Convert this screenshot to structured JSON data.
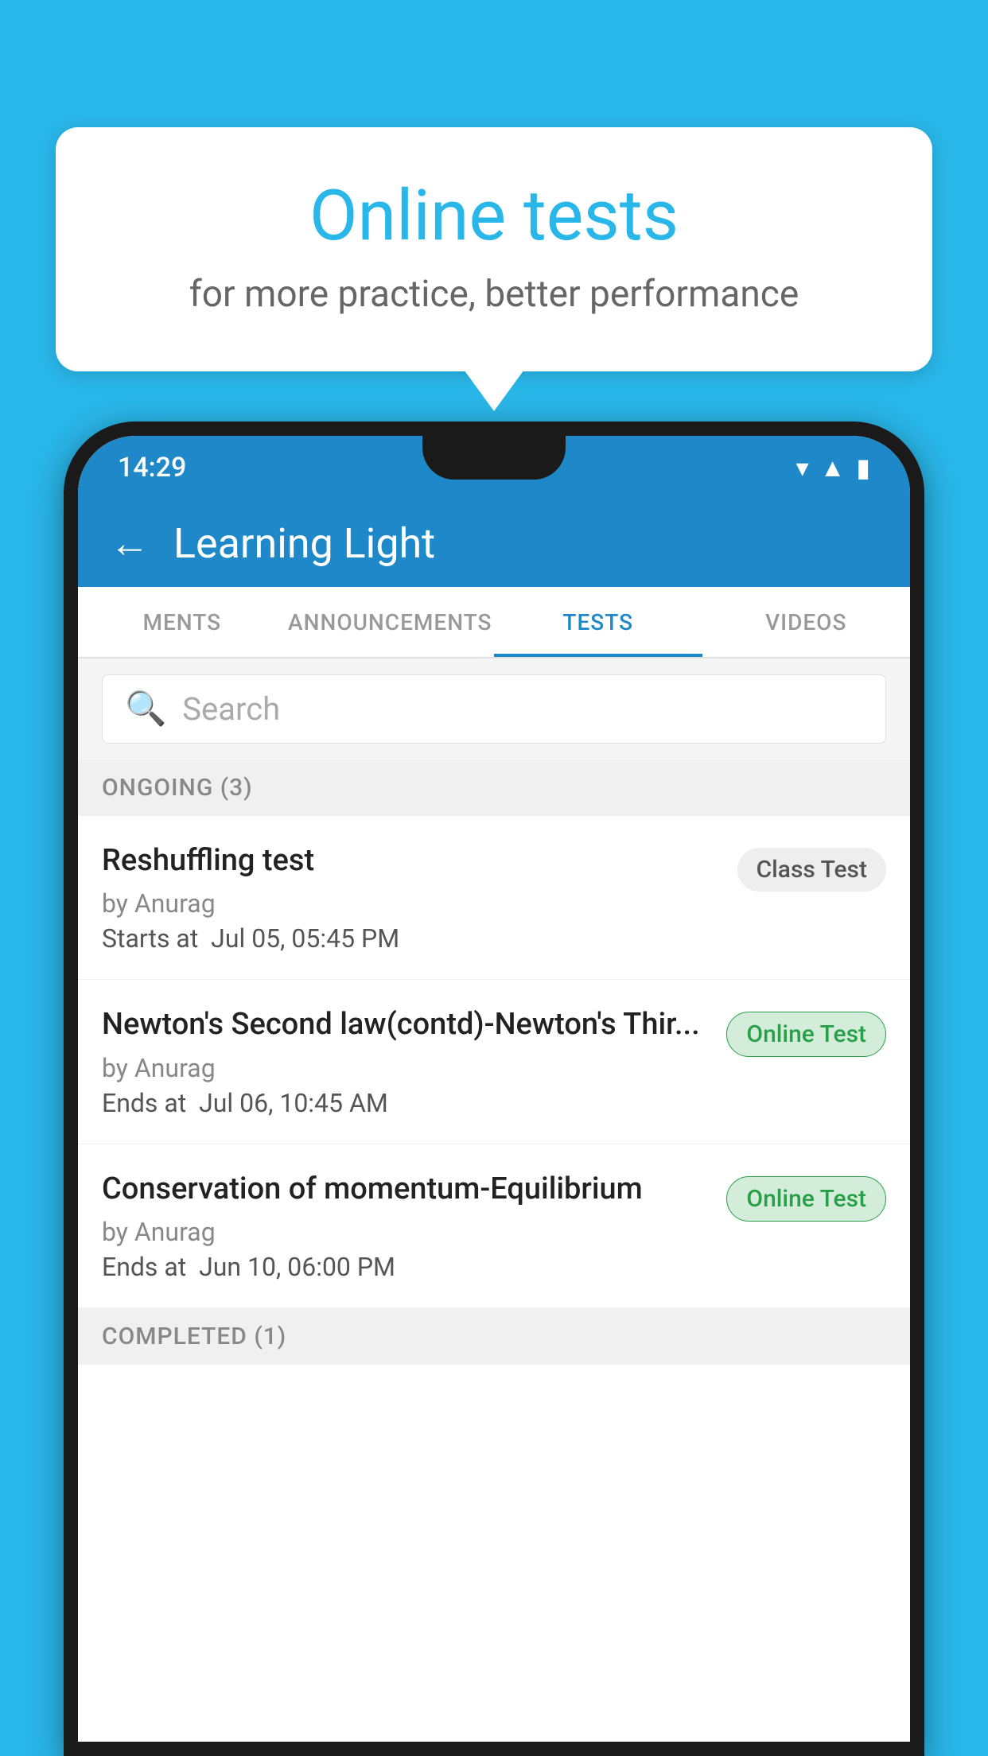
{
  "background": {
    "color": "#29b6e8"
  },
  "speech_bubble": {
    "title": "Online tests",
    "subtitle": "for more practice, better performance"
  },
  "phone": {
    "status_bar": {
      "time": "14:29",
      "icons": [
        "wifi",
        "signal",
        "battery"
      ]
    },
    "app_header": {
      "back_label": "←",
      "title": "Learning Light"
    },
    "tabs": [
      {
        "label": "MENTS",
        "active": false
      },
      {
        "label": "ANNOUNCEMENTS",
        "active": false
      },
      {
        "label": "TESTS",
        "active": true
      },
      {
        "label": "VIDEOS",
        "active": false
      }
    ],
    "search": {
      "placeholder": "Search"
    },
    "section_ongoing": {
      "label": "ONGOING (3)"
    },
    "tests": [
      {
        "name": "Reshuffling test",
        "author": "by Anurag",
        "date_label": "Starts at",
        "date_value": "Jul 05, 05:45 PM",
        "badge": "Class Test",
        "badge_type": "class"
      },
      {
        "name": "Newton's Second law(contd)-Newton's Thir...",
        "author": "by Anurag",
        "date_label": "Ends at",
        "date_value": "Jul 06, 10:45 AM",
        "badge": "Online Test",
        "badge_type": "online"
      },
      {
        "name": "Conservation of momentum-Equilibrium",
        "author": "by Anurag",
        "date_label": "Ends at",
        "date_value": "Jun 10, 06:00 PM",
        "badge": "Online Test",
        "badge_type": "online"
      }
    ],
    "section_completed": {
      "label": "COMPLETED (1)"
    }
  }
}
